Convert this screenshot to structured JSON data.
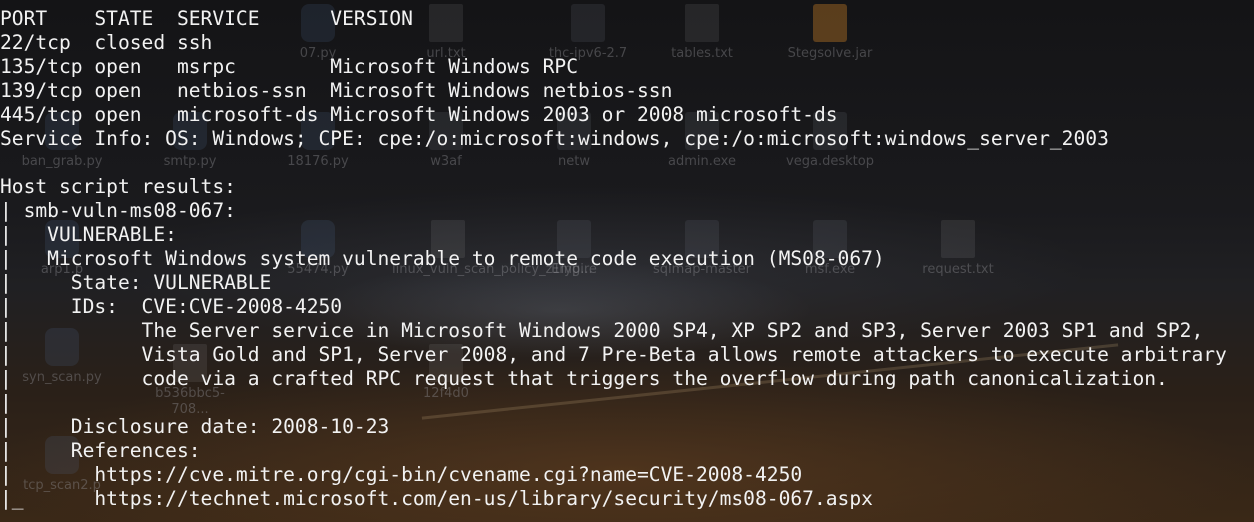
{
  "desktop": {
    "icons": [
      {
        "label": "07.py",
        "icon": "python-file-icon",
        "type": "py"
      },
      {
        "label": "url.txt",
        "icon": "text-file-icon",
        "type": "doc"
      },
      {
        "label": "thc-ipv6-2.7",
        "icon": "folder-icon",
        "type": "folder"
      },
      {
        "label": "tables.txt",
        "icon": "text-file-icon",
        "type": "doc"
      },
      {
        "label": "Stegsolve.jar",
        "icon": "jar-file-icon",
        "type": "jar"
      },
      {
        "label": "ban_grab.py",
        "icon": "python-file-icon",
        "type": "py"
      },
      {
        "label": "smtp.py",
        "icon": "python-file-icon",
        "type": "py"
      },
      {
        "label": "18176.py",
        "icon": "python-file-icon",
        "type": "py"
      },
      {
        "label": "w3af",
        "icon": "folder-icon",
        "type": "folder"
      },
      {
        "label": "netw",
        "icon": "folder-icon",
        "type": "folder"
      },
      {
        "label": "admin.exe",
        "icon": "executable-icon",
        "type": "exe"
      },
      {
        "label": "vega.desktop",
        "icon": "desktop-launcher-icon",
        "type": "exe"
      },
      {
        "label": "arp1.p",
        "icon": "python-file-icon",
        "type": "py"
      },
      {
        "label": "55474.py",
        "icon": "python-file-icon",
        "type": "py"
      },
      {
        "label": "linux_vuln_scan_policy_z1lyg...",
        "icon": "code-file-icon",
        "type": "doc"
      },
      {
        "label": "Empire",
        "icon": "folder-icon",
        "type": "folder"
      },
      {
        "label": "sqlmap-master",
        "icon": "folder-icon",
        "type": "folder"
      },
      {
        "label": "msf.exe",
        "icon": "executable-icon",
        "type": "exe"
      },
      {
        "label": "request.txt",
        "icon": "text-file-icon",
        "type": "doc"
      },
      {
        "label": "syn_scan.py",
        "icon": "python-file-icon",
        "type": "py"
      },
      {
        "label": "b536bbc5-708...",
        "icon": "file-icon",
        "type": "doc"
      },
      {
        "label": "12f4d0",
        "icon": "file-icon",
        "type": "doc"
      },
      {
        "label": "tcp_scan2.p",
        "icon": "python-file-icon",
        "type": "py"
      }
    ]
  },
  "terminal": {
    "lines": [
      "PORT    STATE  SERVICE      VERSION",
      "22/tcp  closed ssh",
      "135/tcp open   msrpc        Microsoft Windows RPC",
      "139/tcp open   netbios-ssn  Microsoft Windows netbios-ssn",
      "445/tcp open   microsoft-ds Microsoft Windows 2003 or 2008 microsoft-ds",
      "Service Info: OS: Windows; CPE: cpe:/o:microsoft:windows, cpe:/o:microsoft:windows_server_2003",
      "",
      "Host script results:",
      "| smb-vuln-ms08-067:",
      "|   VULNERABLE:",
      "|   Microsoft Windows system vulnerable to remote code execution (MS08-067)",
      "|     State: VULNERABLE",
      "|     IDs:  CVE:CVE-2008-4250",
      "|           The Server service in Microsoft Windows 2000 SP4, XP SP2 and SP3, Server 2003 SP1 and SP2,",
      "|           Vista Gold and SP1, Server 2008, and 7 Pre-Beta allows remote attackers to execute arbitrary",
      "|           code via a crafted RPC request that triggers the overflow during path canonicalization.",
      "|",
      "|     Disclosure date: 2008-10-23",
      "|     References:",
      "|       https://cve.mitre.org/cgi-bin/cvename.cgi?name=CVE-2008-4250",
      "|_      https://technet.microsoft.com/en-us/library/security/ms08-067.aspx"
    ]
  }
}
